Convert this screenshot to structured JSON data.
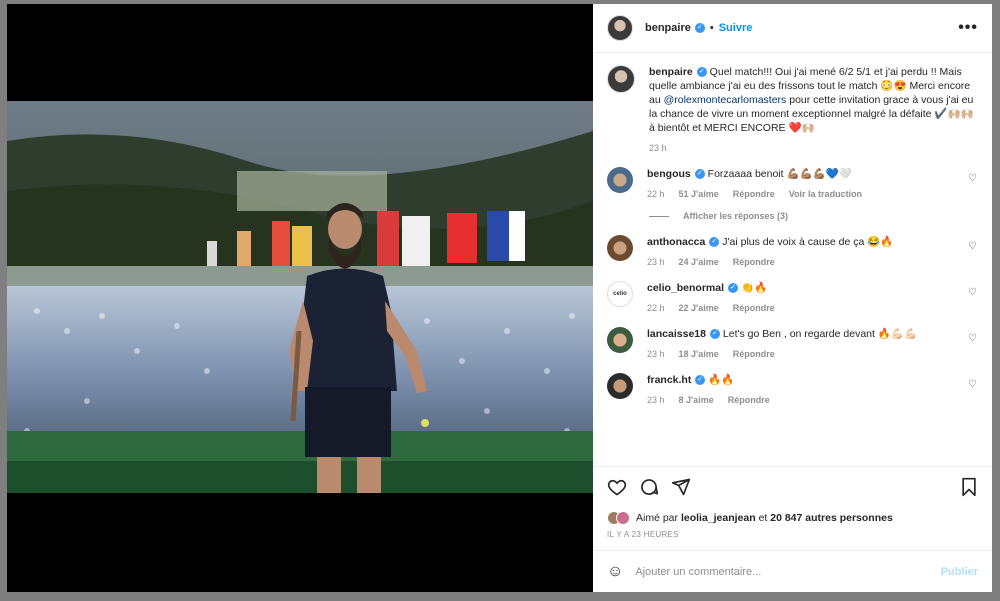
{
  "post": {
    "author": "benpaire",
    "follow_label": "Suivre",
    "more_label": "•••",
    "caption_user": "benpaire",
    "caption_part1": " Quel match!!! Oui j'ai mené 6/2 5/1 et j'ai perdu !! Mais quelle ambiance j'ai eu des frissons tout le match 😳😍 Merci encore au ",
    "caption_mention": "@rolexmontecarlomasters",
    "caption_part2": " pour cette invitation grace à vous j'ai eu la chance de vivre un moment exceptionnel malgré la défaite ✔️🙌🏼🙌🏼 à bientôt et MERCI ENCORE ❤️🙌🏼",
    "caption_time": "23 h"
  },
  "comments": [
    {
      "user": "bengous",
      "text": "Forzaaaa benoit 💪🏽💪🏽💪🏽💙🤍",
      "time": "22 h",
      "likes": "51 J'aime",
      "reply": "Répondre",
      "translate": "Voir la traduction"
    },
    {
      "user": "anthonacca",
      "text": "J'ai plus de voix à cause de ça 😂🔥",
      "time": "23 h",
      "likes": "24 J'aime",
      "reply": "Répondre"
    },
    {
      "user": "celio_benormal",
      "text": "👏🔥",
      "time": "22 h",
      "likes": "22 J'aime",
      "reply": "Répondre"
    },
    {
      "user": "lancaisse18",
      "text": "Let's go Ben , on regarde devant 🔥💪🏻💪🏻",
      "time": "23 h",
      "likes": "18 J'aime",
      "reply": "Répondre"
    },
    {
      "user": "franck.ht",
      "text": "🔥🔥",
      "time": "23 h",
      "likes": "8 J'aime",
      "reply": "Répondre"
    }
  ],
  "replies_label": "Afficher les réponses (3)",
  "celio_logo_text": "celio",
  "likes": {
    "prefix": "Aimé par ",
    "user": "leolia_jeanjean",
    "middle": " et ",
    "others": "20 847 autres personnes"
  },
  "time_ago": "IL Y A 23 HEURES",
  "add_comment": {
    "placeholder": "Ajouter un commentaire...",
    "publish": "Publier"
  },
  "colors": {
    "accent": "#0095f6",
    "verified": "#3897f0",
    "muted": "#8e8e8e"
  }
}
